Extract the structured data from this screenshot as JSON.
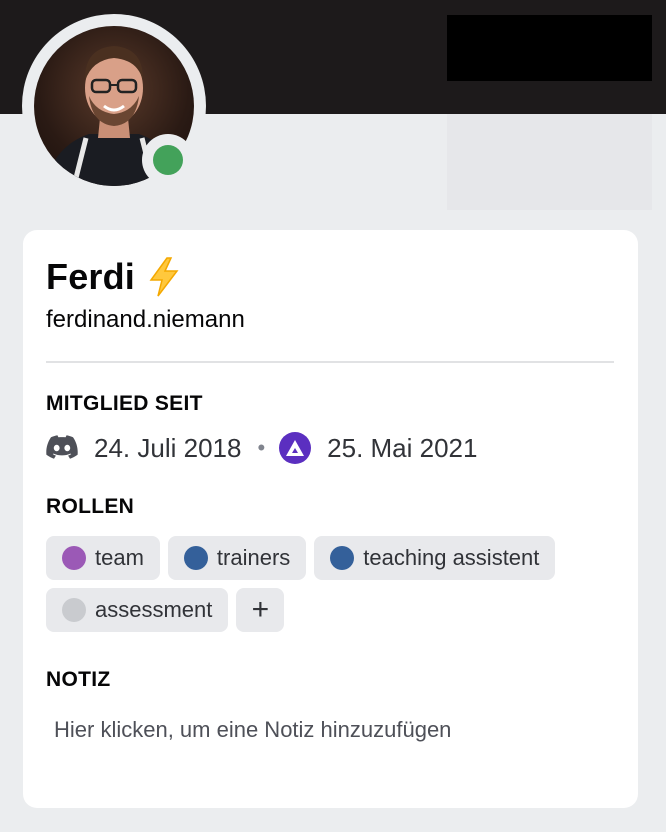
{
  "profile": {
    "display_name": "Ferdi",
    "username": "ferdinand.niemann",
    "status": "online",
    "status_color": "#43a25a"
  },
  "member_since": {
    "title": "MITGLIED SEIT",
    "discord_date": "24. Juli 2018",
    "separator": "•",
    "server_date": "25. Mai 2021"
  },
  "roles": {
    "title": "ROLLEN",
    "items": [
      {
        "label": "team",
        "color": "#9b59b6"
      },
      {
        "label": "trainers",
        "color": "#34609a"
      },
      {
        "label": "teaching assistent",
        "color": "#34609a"
      },
      {
        "label": "assessment",
        "color": "#c9cbcf"
      }
    ],
    "add_label": "+"
  },
  "note": {
    "title": "NOTIZ",
    "placeholder": "Hier klicken, um eine Notiz hinzuzufügen"
  },
  "icons": {
    "discord": "discord-icon",
    "server": "server-icon",
    "status": "online-status-icon",
    "emoji": "lightning-emoji-icon"
  }
}
